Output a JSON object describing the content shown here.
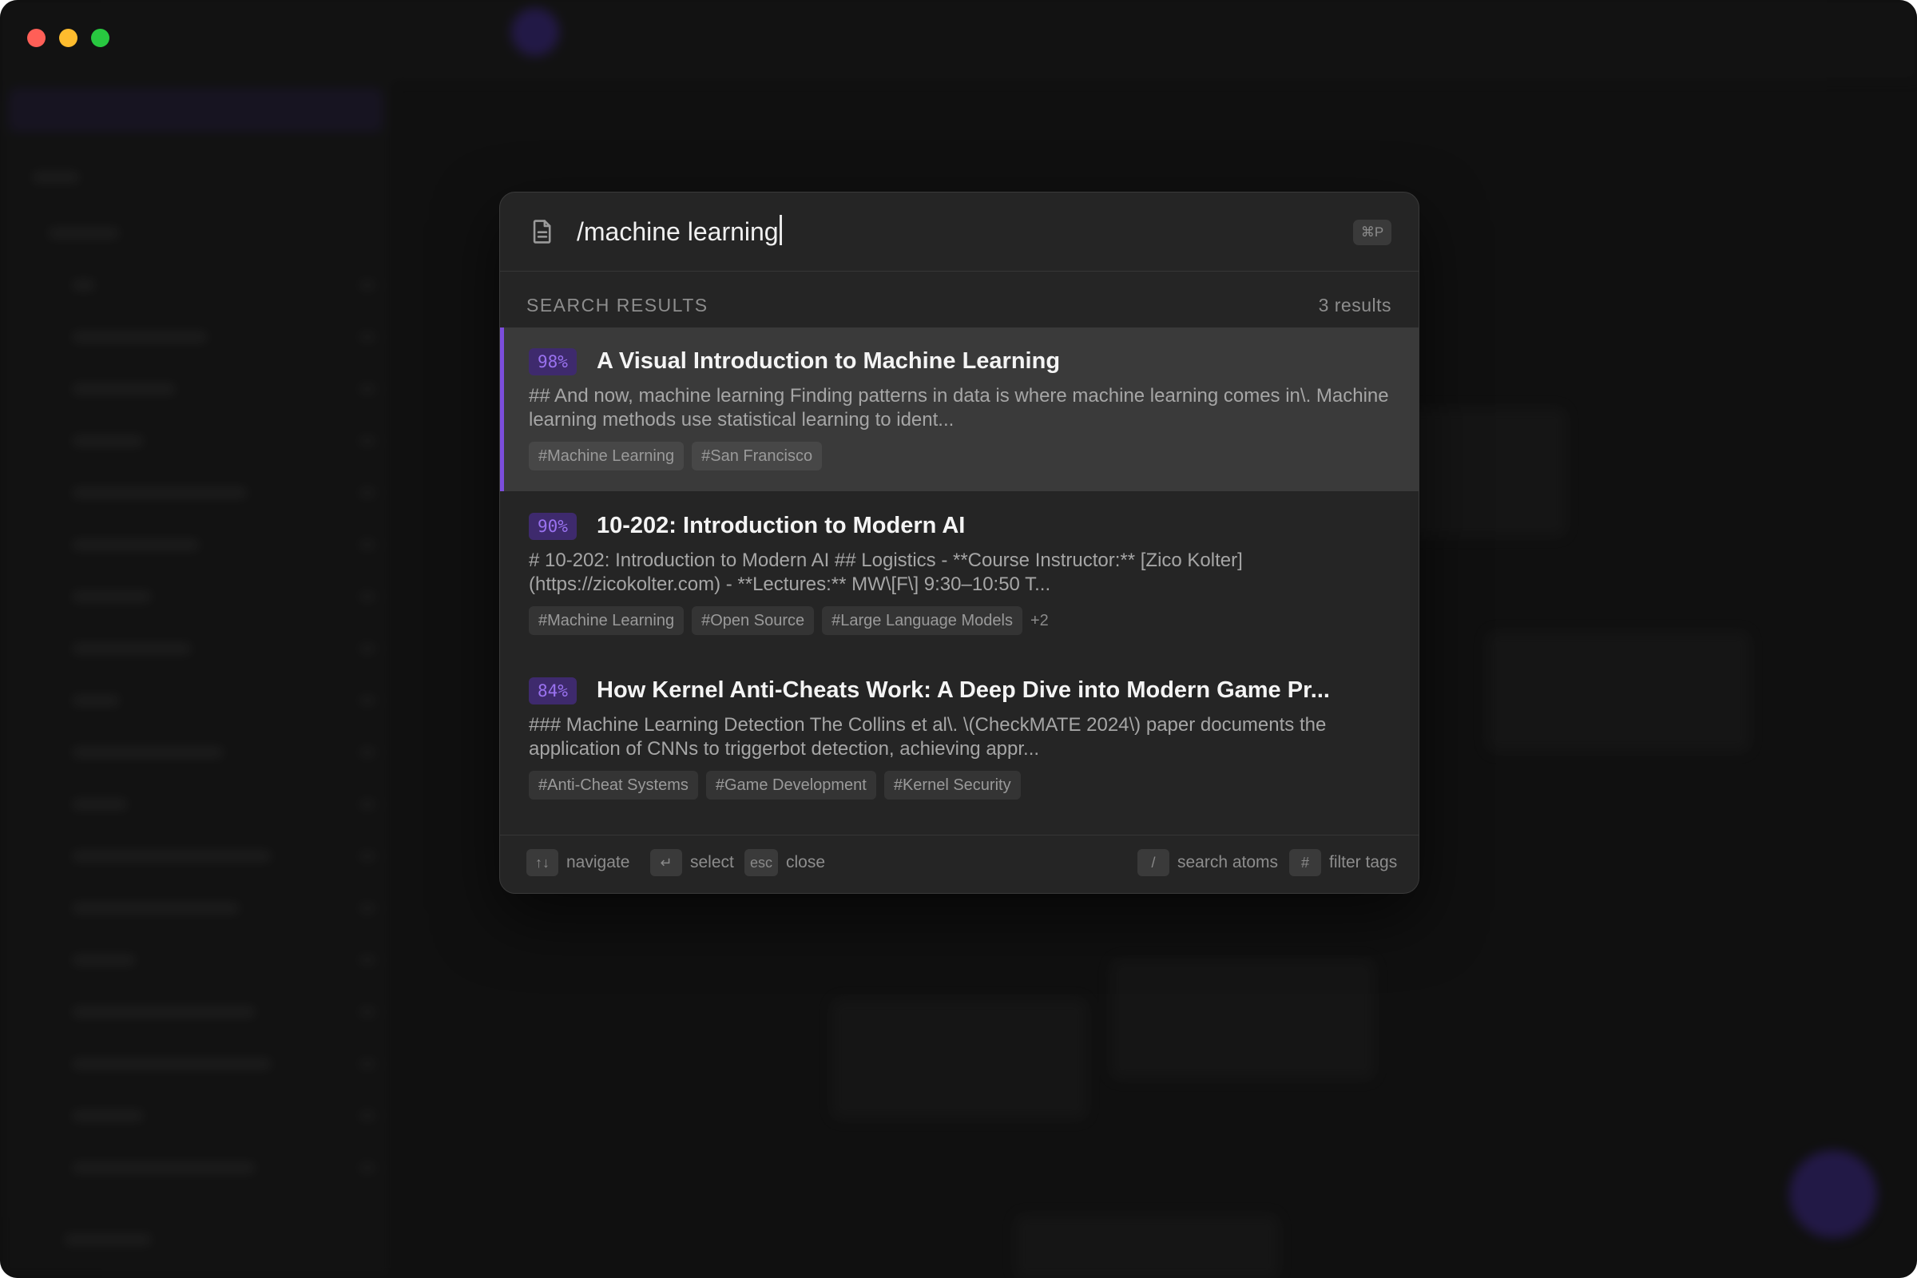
{
  "search": {
    "query": "/machine learning",
    "shortcut": "⌘P"
  },
  "results_header": {
    "label": "SEARCH RESULTS",
    "count": "3 results"
  },
  "results": [
    {
      "score": "98%",
      "title": "A Visual Introduction to Machine Learning",
      "snippet": "## And now, machine learning Finding patterns in data is where machine learning comes in\\. Machine learning methods use statistical learning to ident...",
      "tags": [
        "#Machine Learning",
        "#San Francisco"
      ],
      "more": ""
    },
    {
      "score": "90%",
      "title": "10-202: Introduction to Modern AI",
      "snippet": "# 10-202: Introduction to Modern AI ## Logistics - **Course Instructor:** [Zico Kolter](https://zicokolter.com) - **Lectures:** MW\\[F\\] 9:30–10:50 T...",
      "tags": [
        "#Machine Learning",
        "#Open Source",
        "#Large Language Models"
      ],
      "more": "+2"
    },
    {
      "score": "84%",
      "title": "How Kernel Anti-Cheats Work: A Deep Dive into Modern Game Pr...",
      "snippet": "### Machine Learning Detection The Collins et al\\. \\(CheckMATE 2024\\) paper documents the application of CNNs to triggerbot detection, achieving appr...",
      "tags": [
        "#Anti-Cheat Systems",
        "#Game Development",
        "#Kernel Security"
      ],
      "more": ""
    }
  ],
  "footer": {
    "navigate_key": "↑↓",
    "navigate_label": "navigate",
    "select_key": "↵",
    "select_label": "select",
    "close_key": "esc",
    "close_label": "close",
    "atoms_key": "/",
    "atoms_label": "search atoms",
    "tags_key": "#",
    "tags_label": "filter tags"
  },
  "colors": {
    "accent": "#7c4ddc",
    "score_bg": "#3e2a6d",
    "score_text": "#9a72f0"
  }
}
